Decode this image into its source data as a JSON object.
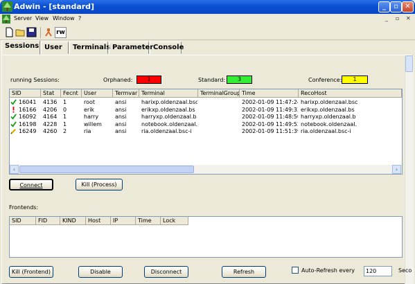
{
  "window": {
    "title": "Adwin - [standard]"
  },
  "menu": {
    "items": [
      "Server",
      "View",
      "Window",
      "?"
    ]
  },
  "toolbar": {
    "rw_label": "rw"
  },
  "tabs": [
    "Sessions",
    "User",
    "Terminals",
    "Parameter",
    "Console"
  ],
  "sessions": {
    "running_label": "running Sessions:",
    "orphaned_label": "Orphaned:",
    "orphaned_count": "1",
    "standard_label": "Standard:",
    "standard_count": "3",
    "conference_label": "Conference:",
    "conference_count": "1",
    "colors": {
      "orphaned": "#ff0000",
      "standard": "#33ee33",
      "conference": "#ffff00"
    },
    "columns": [
      "SID",
      "Stat",
      "Fecnt",
      "User",
      "Termvar",
      "Terminal",
      "TerminalGroup",
      "Time",
      "RecoHost"
    ],
    "rows": [
      {
        "icon": "green-check-icon",
        "sid": "16041",
        "stat": "4136",
        "fecnt": "1",
        "user": "root",
        "termvar": "ansi",
        "terminal": "harixp.oldenzaal.bsc",
        "group": "",
        "time": "2002-01-09 11:47:24",
        "recohost": "harixp.oldenzaal.bsc"
      },
      {
        "icon": "red-exclamation-icon",
        "sid": "16166",
        "stat": "4206",
        "fecnt": "0",
        "user": "erik",
        "termvar": "ansi",
        "terminal": "erikxp.oldenzaal.bs",
        "group": "",
        "time": "2002-01-09 11:49:33",
        "recohost": "erikxp.oldenzaal.bs"
      },
      {
        "icon": "green-check-icon",
        "sid": "16092",
        "stat": "4164",
        "fecnt": "1",
        "user": "harry",
        "termvar": "ansi",
        "terminal": "harryxp.oldenzaal.b",
        "group": "",
        "time": "2002-01-09 11:48:50",
        "recohost": "harryxp.oldenzaal.b"
      },
      {
        "icon": "green-check-icon",
        "sid": "16198",
        "stat": "4228",
        "fecnt": "1",
        "user": "willem",
        "termvar": "ansi",
        "terminal": "notebook.oldenzaal.",
        "group": "",
        "time": "2002-01-09 11:49:52",
        "recohost": "notebook.oldenzaal."
      },
      {
        "icon": "yellow-pencil-icon",
        "sid": "16249",
        "stat": "4260",
        "fecnt": "2",
        "user": "ria",
        "termvar": "ansi",
        "terminal": "ria.oldenzaal.bsc-i",
        "group": "",
        "time": "2002-01-09 11:51:39",
        "recohost": "ria.oldenzaal.bsc-i"
      }
    ],
    "connect_button": "Connect",
    "kill_process_button": "Kill (Process)"
  },
  "frontends": {
    "label": "Frontends:",
    "columns": [
      "SID",
      "FID",
      "KIND",
      "Host",
      "IP",
      "Time",
      "Lock"
    ],
    "kill_frontend_button": "Kill (Frontend)",
    "disable_button": "Disable",
    "disconnect_button": "Disconnect",
    "refresh_button": "Refresh",
    "auto_refresh_label": "Auto-Refresh every",
    "auto_refresh_value": "120",
    "seconds_label": "Seco"
  }
}
